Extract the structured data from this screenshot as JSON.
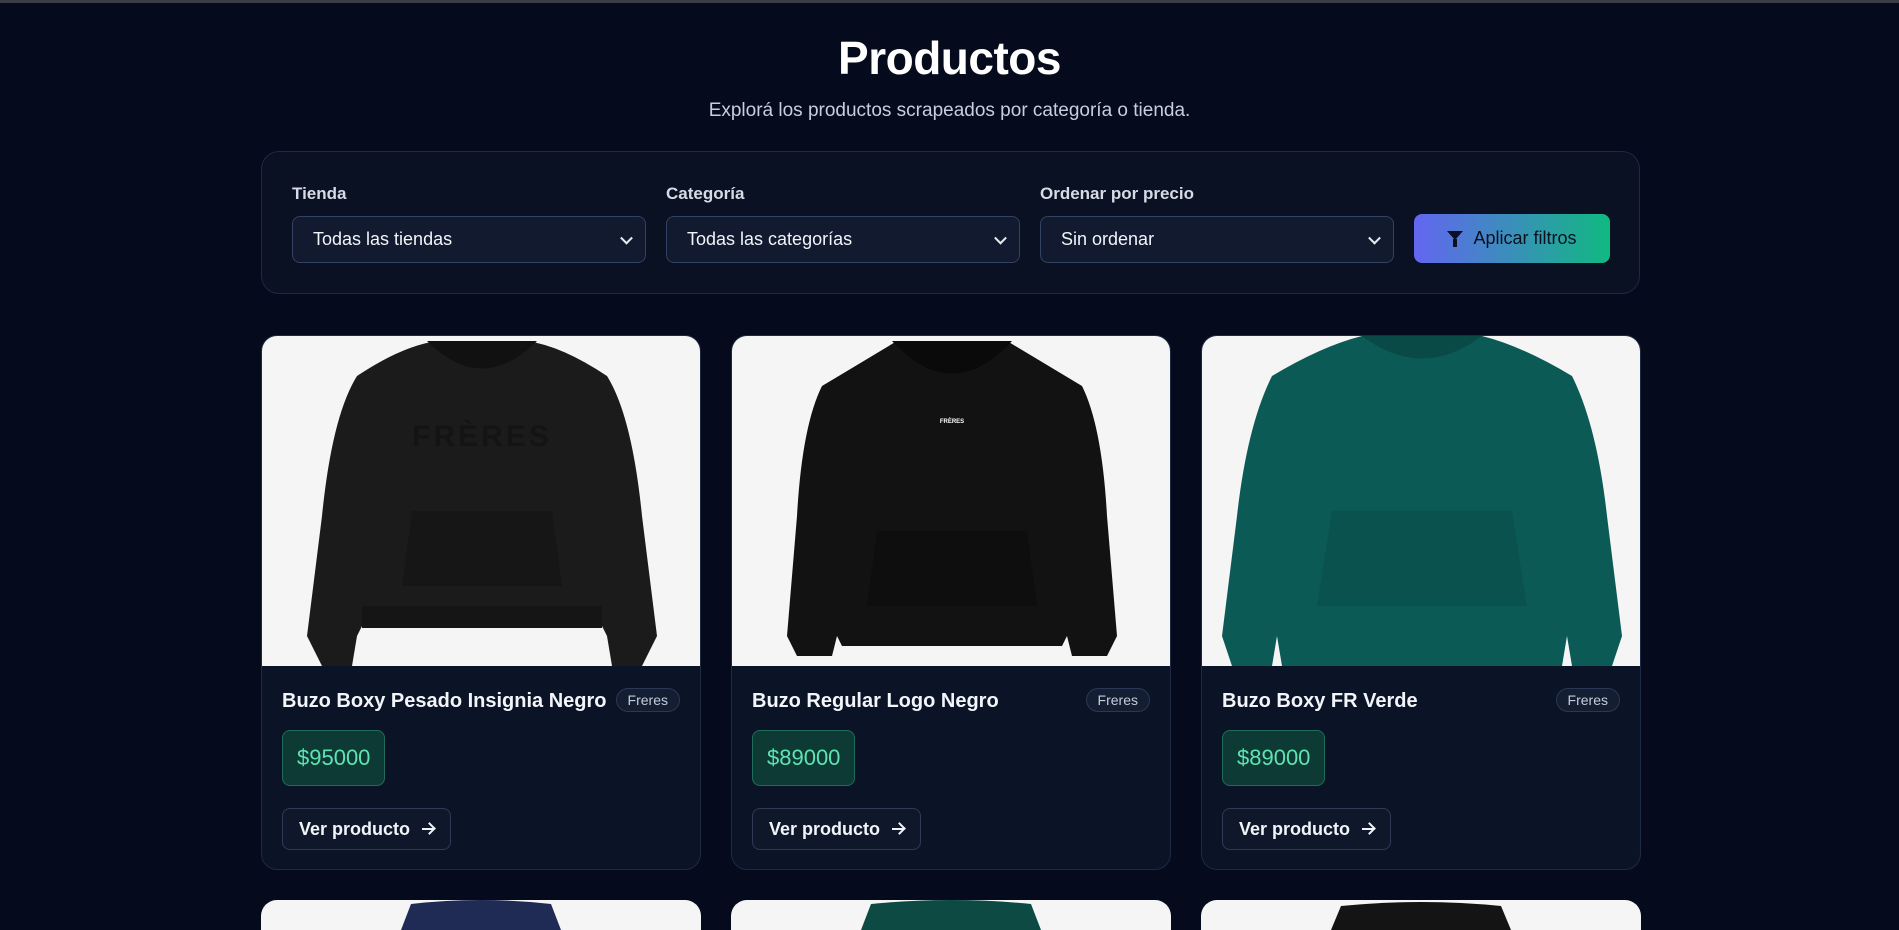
{
  "header": {
    "title": "Productos",
    "subtitle": "Explorá los productos scrapeados por categoría o tienda."
  },
  "filters": {
    "store": {
      "label": "Tienda",
      "value": "Todas las tiendas"
    },
    "category": {
      "label": "Categoría",
      "value": "Todas las categorías"
    },
    "sort": {
      "label": "Ordenar por precio",
      "value": "Sin ordenar"
    },
    "apply_label": "Aplicar filtros",
    "apply_icon": "funnel-icon"
  },
  "colors": {
    "background": "#050a1c",
    "card": "#0b1426",
    "accent_start": "#6366f1",
    "accent_end": "#10b981",
    "price_text": "#5fe3b1"
  },
  "products": [
    {
      "name": "Buzo Boxy Pesado Insignia Negro",
      "store": "Freres",
      "price": "$95000",
      "cta": "Ver producto",
      "image": "black-hoodie-embossed-logo",
      "shirt_color": "#1b1b1b"
    },
    {
      "name": "Buzo Regular Logo Negro",
      "store": "Freres",
      "price": "$89000",
      "cta": "Ver producto",
      "image": "black-hoodie-small-logo",
      "shirt_color": "#121212"
    },
    {
      "name": "Buzo Boxy FR Verde",
      "store": "Freres",
      "price": "$89000",
      "cta": "Ver producto",
      "image": "green-sweatshirt",
      "shirt_color": "#0c5a55"
    }
  ]
}
